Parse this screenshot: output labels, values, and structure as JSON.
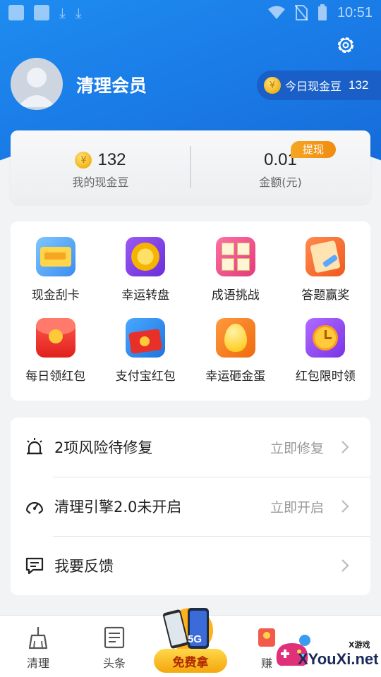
{
  "status_bar": {
    "time": "10:51"
  },
  "header": {
    "username": "清理会员"
  },
  "today_beans": {
    "label": "今日现金豆",
    "value": "132"
  },
  "balance": {
    "beans_value": "132",
    "beans_label": "我的现金豆",
    "amount_value": "0.01",
    "amount_label": "金额(元)",
    "withdraw_label": "提现"
  },
  "grid_items": [
    {
      "label": "现金刮卡",
      "icon": "scratch-card-icon"
    },
    {
      "label": "幸运转盘",
      "icon": "lucky-wheel-icon"
    },
    {
      "label": "成语挑战",
      "icon": "idiom-challenge-icon"
    },
    {
      "label": "答题赢奖",
      "icon": "quiz-icon"
    },
    {
      "label": "每日领红包",
      "icon": "red-packet-icon"
    },
    {
      "label": "支付宝红包",
      "icon": "alipay-red-packet-icon"
    },
    {
      "label": "幸运砸金蛋",
      "icon": "golden-egg-icon"
    },
    {
      "label": "红包限时领",
      "icon": "alarm-clock-icon"
    }
  ],
  "list_items": [
    {
      "title": "2项风险待修复",
      "action": "立即修复",
      "icon": "alarm-icon"
    },
    {
      "title": "清理引擎2.0未开启",
      "action": "立即开启",
      "icon": "speedometer-icon"
    },
    {
      "title": "我要反馈",
      "action": "",
      "icon": "feedback-icon"
    }
  ],
  "bottom_nav": {
    "clean": "清理",
    "headlines": "头条",
    "promo": "免费拿",
    "promo_tag": "5G",
    "earn": "赚"
  },
  "watermark": {
    "text": "XYouXi.net",
    "small": "X游戏"
  },
  "colors": {
    "header_blue": "#1a7be6",
    "pill_blue": "#1a5fc8",
    "withdraw_orange": "#f5a623",
    "coin_gold": "#f2b418"
  }
}
